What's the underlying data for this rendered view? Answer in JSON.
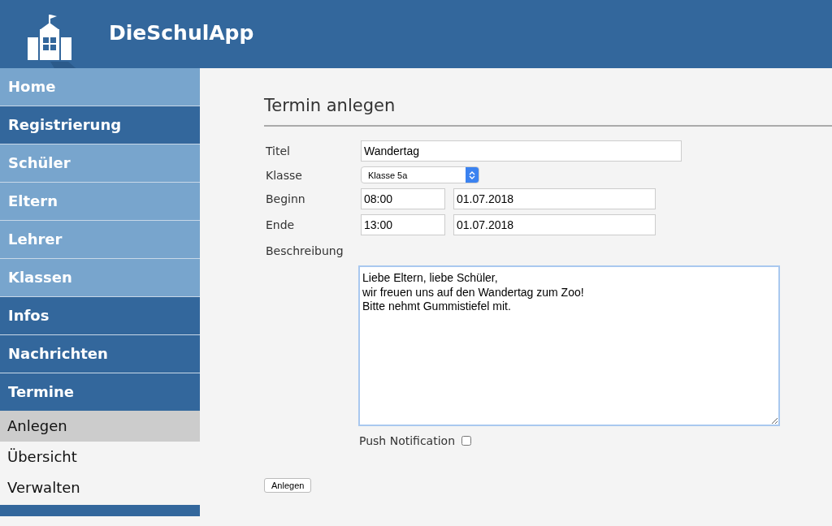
{
  "header": {
    "title": "DieSchulApp"
  },
  "sidebar": {
    "items": [
      {
        "label": "Home",
        "color": "#78a5cd"
      },
      {
        "label": "Registrierung",
        "color": "#33679c"
      },
      {
        "label": "Schüler",
        "color": "#78a5cd"
      },
      {
        "label": "Eltern",
        "color": "#78a5cd"
      },
      {
        "label": "Lehrer",
        "color": "#78a5cd"
      },
      {
        "label": "Klassen",
        "color": "#78a5cd"
      },
      {
        "label": "Infos",
        "color": "#33679c"
      },
      {
        "label": "Nachrichten",
        "color": "#33679c"
      },
      {
        "label": "Termine",
        "color": "#33679c",
        "children": [
          {
            "label": "Anlegen",
            "selected": true
          },
          {
            "label": "Übersicht",
            "selected": false
          },
          {
            "label": "Verwalten",
            "selected": false
          }
        ]
      }
    ]
  },
  "form": {
    "title": "Termin anlegen",
    "rows": [
      {
        "kind": "text",
        "label": "Titel",
        "value": "Wandertag"
      },
      {
        "kind": "select",
        "label": "Klasse",
        "value": "Klasse 5a"
      },
      {
        "kind": "timedate",
        "label": "Beginn",
        "time": "08:00",
        "date": "01.07.2018"
      },
      {
        "kind": "timedate",
        "label": "Ende",
        "time": "13:00",
        "date": "01.07.2018"
      },
      {
        "kind": "textarea",
        "label": "Beschreibung",
        "value": "Liebe Eltern, liebe Schüler,\nwir freuen uns auf den Wandertag zum Zoo!\nBitte nehmt Gummistiefel mit."
      }
    ],
    "push": {
      "label": "Push Notification",
      "checked": false
    },
    "submit": "Anlegen"
  }
}
